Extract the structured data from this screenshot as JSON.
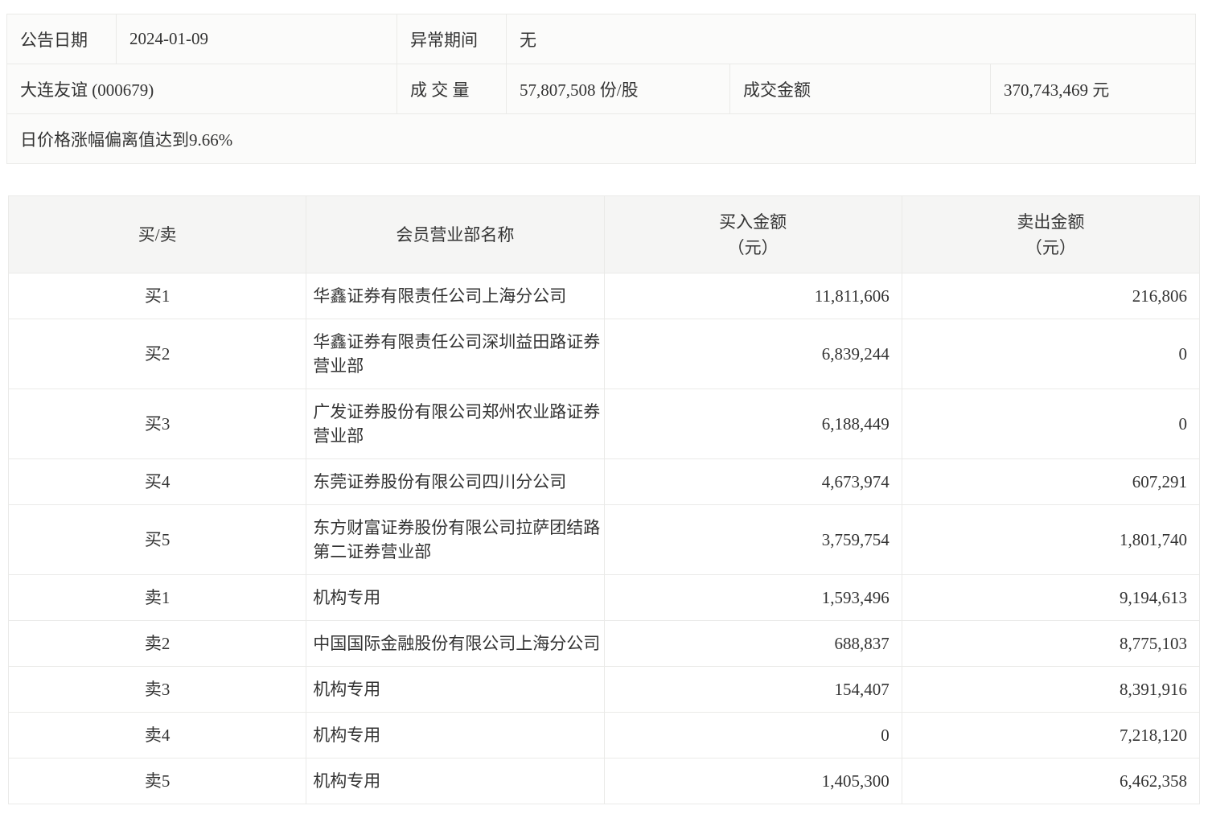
{
  "colors": {
    "page_bg": "#ffffff",
    "cell_bg": "#fbfbfa",
    "header_bg": "#f5f5f4",
    "border": "#eaeae8",
    "text": "#333333"
  },
  "summary": {
    "announce_date_label": "公告日期",
    "announce_date": "2024-01-09",
    "abnormal_period_label": "异常期间",
    "abnormal_period": "无",
    "stock": "大连友谊 (000679)",
    "volume_label": "成 交 量",
    "volume": "57,807,508 份/股",
    "turnover_label": "成交金额",
    "turnover": "370,743,469 元",
    "deviation_note": "日价格涨幅偏离值达到9.66%"
  },
  "rank_table": {
    "headers": {
      "side": "买/卖",
      "broker": "会员营业部名称",
      "buy": "买入金额",
      "sell": "卖出金额",
      "unit": "（元）"
    },
    "rows": [
      {
        "side": "买1",
        "broker": "华鑫证券有限责任公司上海分公司",
        "buy": "11,811,606",
        "sell": "216,806"
      },
      {
        "side": "买2",
        "broker": "华鑫证券有限责任公司深圳益田路证券营业部",
        "buy": "6,839,244",
        "sell": "0"
      },
      {
        "side": "买3",
        "broker": "广发证券股份有限公司郑州农业路证券营业部",
        "buy": "6,188,449",
        "sell": "0"
      },
      {
        "side": "买4",
        "broker": "东莞证券股份有限公司四川分公司",
        "buy": "4,673,974",
        "sell": "607,291"
      },
      {
        "side": "买5",
        "broker": "东方财富证券股份有限公司拉萨团结路第二证券营业部",
        "buy": "3,759,754",
        "sell": "1,801,740"
      },
      {
        "side": "卖1",
        "broker": "机构专用",
        "buy": "1,593,496",
        "sell": "9,194,613"
      },
      {
        "side": "卖2",
        "broker": "中国国际金融股份有限公司上海分公司",
        "buy": "688,837",
        "sell": "8,775,103"
      },
      {
        "side": "卖3",
        "broker": "机构专用",
        "buy": "154,407",
        "sell": "8,391,916"
      },
      {
        "side": "卖4",
        "broker": "机构专用",
        "buy": "0",
        "sell": "7,218,120"
      },
      {
        "side": "卖5",
        "broker": "机构专用",
        "buy": "1,405,300",
        "sell": "6,462,358"
      }
    ]
  }
}
